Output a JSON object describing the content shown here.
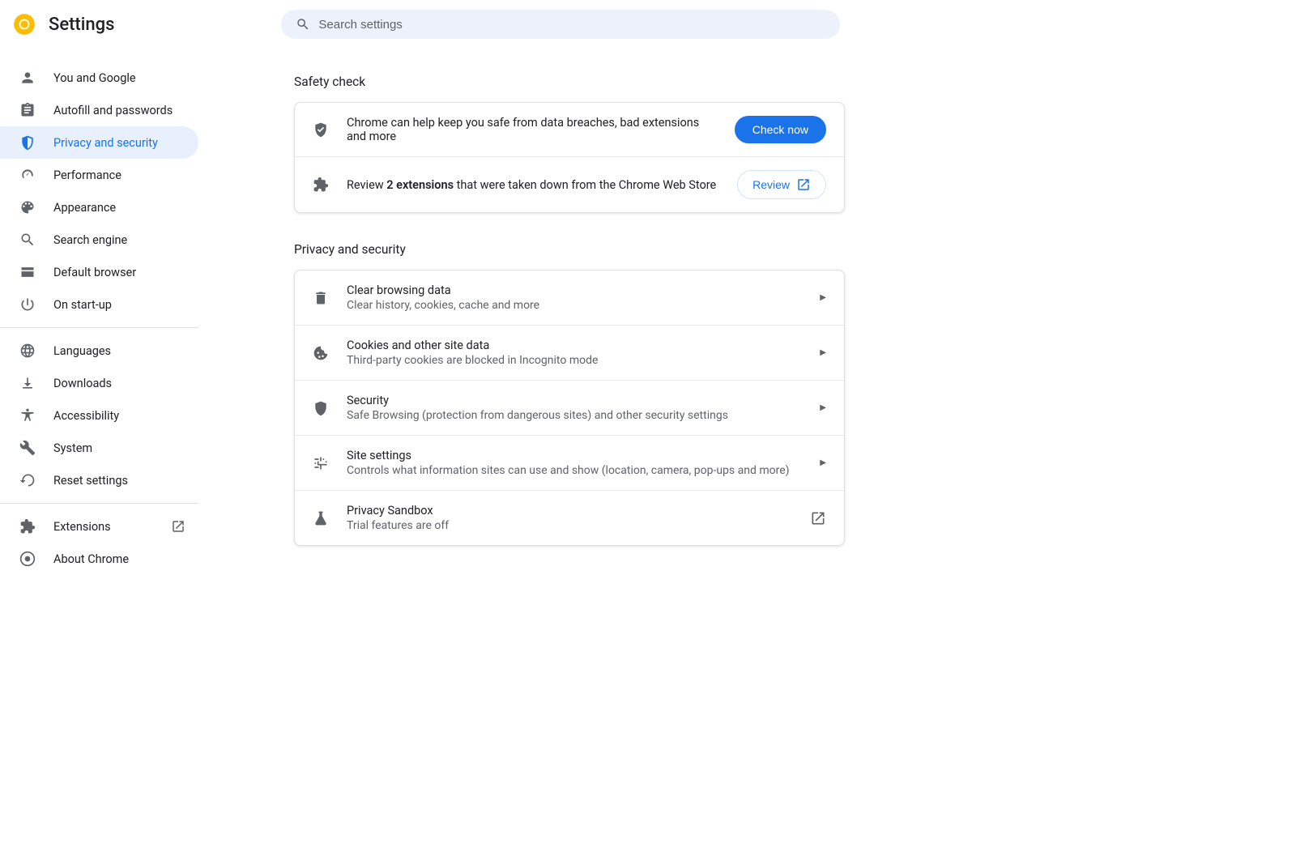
{
  "header": {
    "title": "Settings",
    "search_placeholder": "Search settings"
  },
  "sidebar": {
    "items": [
      {
        "key": "you-and-google",
        "label": "You and Google",
        "icon": "person-icon"
      },
      {
        "key": "autofill",
        "label": "Autofill and passwords",
        "icon": "clipboard-icon"
      },
      {
        "key": "privacy",
        "label": "Privacy and security",
        "icon": "shield-icon",
        "selected": true
      },
      {
        "key": "performance",
        "label": "Performance",
        "icon": "speedometer-icon"
      },
      {
        "key": "appearance",
        "label": "Appearance",
        "icon": "palette-icon"
      },
      {
        "key": "search-engine",
        "label": "Search engine",
        "icon": "search-icon"
      },
      {
        "key": "default-browser",
        "label": "Default browser",
        "icon": "browser-icon"
      },
      {
        "key": "on-startup",
        "label": "On start-up",
        "icon": "power-icon"
      }
    ],
    "items2": [
      {
        "key": "languages",
        "label": "Languages",
        "icon": "globe-icon"
      },
      {
        "key": "downloads",
        "label": "Downloads",
        "icon": "download-icon"
      },
      {
        "key": "accessibility",
        "label": "Accessibility",
        "icon": "accessibility-icon"
      },
      {
        "key": "system",
        "label": "System",
        "icon": "wrench-icon"
      },
      {
        "key": "reset",
        "label": "Reset settings",
        "icon": "restore-icon"
      }
    ],
    "items3": [
      {
        "key": "extensions",
        "label": "Extensions",
        "icon": "puzzle-icon",
        "external": true
      },
      {
        "key": "about",
        "label": "About Chrome",
        "icon": "chrome-icon"
      }
    ]
  },
  "safety_check": {
    "section_title": "Safety check",
    "row1_text": "Chrome can help keep you safe from data breaches, bad extensions and more",
    "row1_button": "Check now",
    "row2_prefix": "Review ",
    "row2_bold": "2 extensions",
    "row2_suffix": " that were taken down from the Chrome Web Store",
    "row2_button": "Review"
  },
  "privacy": {
    "section_title": "Privacy and security",
    "rows": [
      {
        "title": "Clear browsing data",
        "sub": "Clear history, cookies, cache and more",
        "icon": "trash-icon"
      },
      {
        "title": "Cookies and other site data",
        "sub": "Third-party cookies are blocked in Incognito mode",
        "icon": "cookie-icon"
      },
      {
        "title": "Security",
        "sub": "Safe Browsing (protection from dangerous sites) and other security settings",
        "icon": "shield-icon"
      },
      {
        "title": "Site settings",
        "sub": "Controls what information sites can use and show (location, camera, pop-ups and more)",
        "icon": "tune-icon"
      },
      {
        "title": "Privacy Sandbox",
        "sub": "Trial features are off",
        "icon": "flask-icon",
        "external": true
      }
    ]
  }
}
